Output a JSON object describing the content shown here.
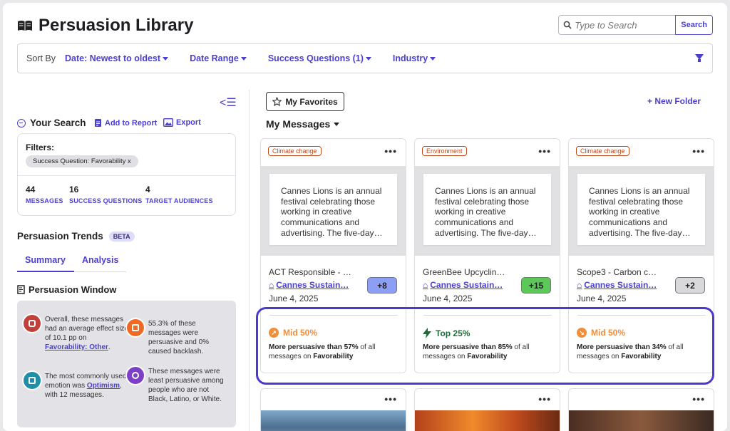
{
  "header": {
    "title": "Persuasion Library",
    "search_placeholder": "Type to Search",
    "search_button": "Search"
  },
  "filterbar": {
    "sort_label": "Sort By",
    "sort_value": "Date: Newest to oldest",
    "date_range": "Date Range",
    "success_questions": "Success Questions (1)",
    "industry": "Industry"
  },
  "sidebar": {
    "your_search": "Your Search",
    "add_to_report": "Add to Report",
    "export": "Export",
    "filters_label": "Filters:",
    "filter_chip": "Success Question: Favorability x",
    "stats": [
      {
        "value": "44",
        "label": "MESSAGES"
      },
      {
        "value": "16",
        "label": "SUCCESS QUESTIONS"
      },
      {
        "value": "4",
        "label": "TARGET AUDIENCES"
      }
    ],
    "trends_title": "Persuasion Trends",
    "beta": "BETA",
    "tabs": [
      "Summary",
      "Analysis"
    ],
    "window_title": "Persuasion Window",
    "insights": {
      "i1_pre": "Overall, these messages had an average effect size of 10.1 pp on ",
      "i1_link": "Favorability: Other",
      "i1_post": ".",
      "i2": "55.3% of these messages were persuasive and 0% caused backlash.",
      "i3_pre": "The most commonly used emotion was ",
      "i3_link": "Optimism",
      "i3_post": ", with 12 messages.",
      "i4": "These messages were least persuasive among people who are not Black, Latino, or White."
    }
  },
  "main": {
    "favorites": "My Favorites",
    "new_folder": "+ New Folder",
    "my_messages": "My Messages",
    "cards": [
      {
        "tag": "Climate change",
        "preview": "Cannes Lions is an annual festival celebrating those working in creative communications and advertising. The five-day…",
        "title": "ACT Responsible - …",
        "link": "Cannes Sustain…",
        "date": "June 4, 2025",
        "score": "+8",
        "score_color": "#8d9ef5",
        "rank": "Mid 50%",
        "rank_color": "#f08f3a",
        "more_pre": "More persuasive than ",
        "more_pct": "57%",
        "more_mid": " of all messages on ",
        "more_q": "Favorability"
      },
      {
        "tag": "Environment",
        "preview": "Cannes Lions is an annual festival celebrating those working in creative communications and advertising. The five-day…",
        "title": "GreenBee Upcyclin…",
        "link": "Cannes Sustain…",
        "date": "June 4, 2025",
        "score": "+15",
        "score_color": "#5cc85a",
        "rank": "Top 25%",
        "rank_color": "#1f6b39",
        "more_pre": "More persuasive than ",
        "more_pct": "85%",
        "more_mid": " of all messages on ",
        "more_q": "Favorability"
      },
      {
        "tag": "Climate change",
        "preview": "Cannes Lions is an annual festival celebrating those working in creative communications and advertising. The five-day…",
        "title": "Scope3 - Carbon c…",
        "link": "Cannes Sustain…",
        "date": "June 4, 2025",
        "score": "+2",
        "score_color": "#d9d9dc",
        "rank": "Mid 50%",
        "rank_color": "#f08f3a",
        "more_pre": "More persuasive than ",
        "more_pct": "34%",
        "more_mid": " of all messages on ",
        "more_q": "Favorability"
      }
    ]
  }
}
